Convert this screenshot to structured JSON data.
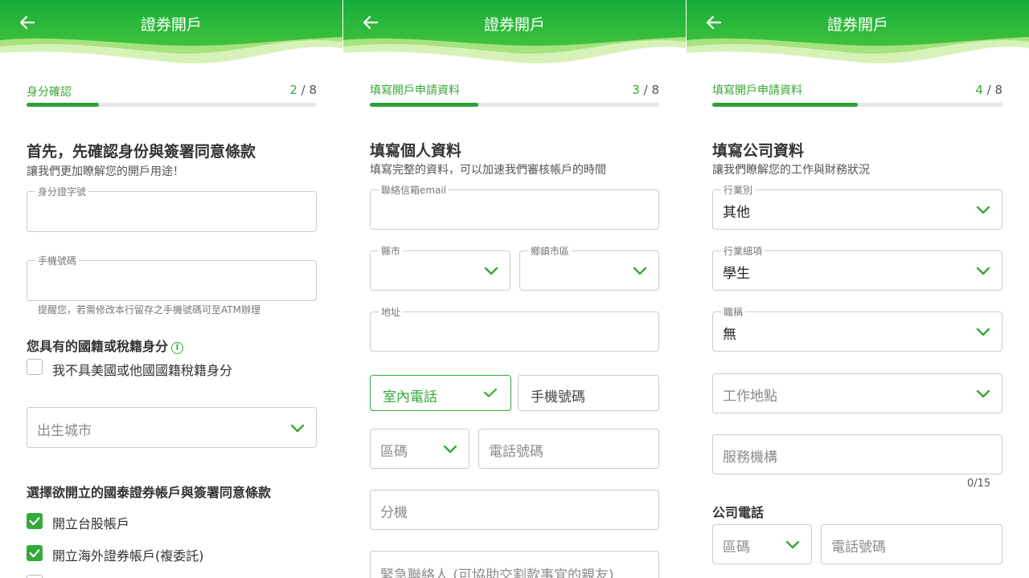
{
  "colors": {
    "accent": "#34a93b",
    "header": "#1db33e"
  },
  "panel1": {
    "title": "證券開戶",
    "step_name": "身分確認",
    "step_current": "2",
    "step_total": "8",
    "progress": 0.25,
    "heading": "首先，先確認身份與簽署同意條款",
    "subheading": "讓我們更加瞭解您的開戶用途！",
    "id_label": "身分證字號",
    "phone_label": "手機號碼",
    "phone_hint": "提醒您，若需修改本行留存之手機號碼可至ATM辦理",
    "nationality_title": "您具有的國籍或稅籍身分",
    "info_glyph": "i",
    "no_us_label": "我不具美國或他國國籍稅籍身分",
    "birth_city_placeholder": "出生城市",
    "account_section": "選擇欲開立的國泰證券帳戶與簽署同意條款",
    "acct_tw": "開立台股帳戶",
    "acct_overseas": "開立海外證券帳戶(複委託)"
  },
  "panel2": {
    "title": "證券開戶",
    "step_name": "填寫開戶申請資料",
    "step_current": "3",
    "step_total": "8",
    "progress": 0.375,
    "heading": "填寫個人資料",
    "subheading": "填寫完整的資料，可以加速我們審核帳戶的時間",
    "email_label": "聯絡信箱email",
    "county_label": "縣市",
    "township_label": "鄉鎮市區",
    "address_label": "地址",
    "home_phone_btn": "室內電話",
    "mobile_btn": "手機號碼",
    "area_code_placeholder": "區碼",
    "phone_number_placeholder": "電話號碼",
    "ext_placeholder": "分機",
    "emergency_placeholder": "緊急聯絡人 (可協助交割款事宜的親友)"
  },
  "panel3": {
    "title": "證券開戶",
    "step_name": "填寫開戶申請資料",
    "step_current": "4",
    "step_total": "8",
    "progress": 0.5,
    "heading": "填寫公司資料",
    "subheading": "讓我們瞭解您的工作與財務狀況",
    "industry_label": "行業別",
    "industry_value": "其他",
    "industry_detail_label": "行業細項",
    "industry_detail_value": "學生",
    "position_label": "職稱",
    "position_value": "無",
    "work_location_placeholder": "工作地點",
    "organization_placeholder": "服務機構",
    "counter": "0/15",
    "company_phone_title": "公司電話",
    "area_code_placeholder": "區碼",
    "phone_number_placeholder": "電話號碼"
  }
}
